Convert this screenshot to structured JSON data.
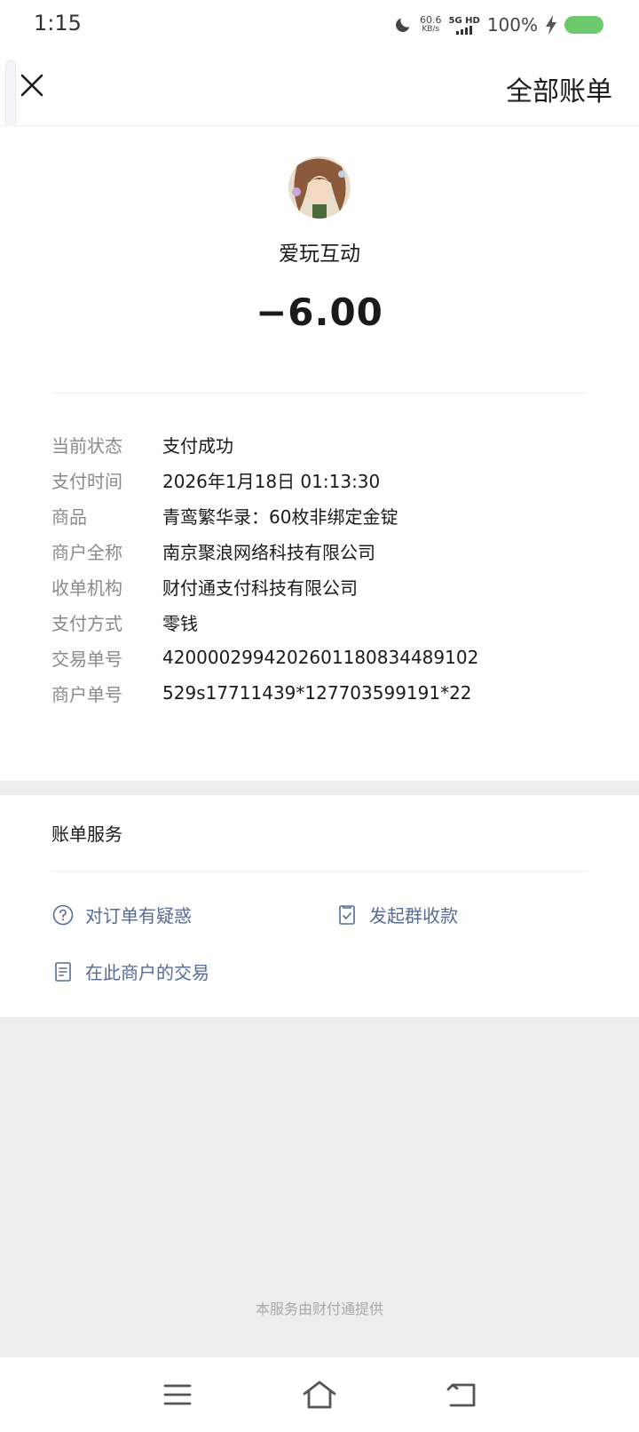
{
  "status_bar": {
    "time": "1:15",
    "net_speed_value": "60.6",
    "net_speed_unit": "KB/s",
    "network_label": "5G HD",
    "battery_percent": "100%",
    "battery_color": "#6cc96e"
  },
  "header": {
    "close_icon": "close-icon",
    "all_bills_label": "全部账单"
  },
  "transaction": {
    "merchant_name": "爱玩互动",
    "amount": "−6.00",
    "details": [
      {
        "label": "当前状态",
        "value": "支付成功"
      },
      {
        "label": "支付时间",
        "value": "2026年1月18日 01:13:30"
      },
      {
        "label": "商品",
        "value": "青鸾繁华录：60枚非绑定金锭"
      },
      {
        "label": "商户全称",
        "value": "南京聚浪网络科技有限公司"
      },
      {
        "label": "收单机构",
        "value": "财付通支付科技有限公司"
      },
      {
        "label": "支付方式",
        "value": "零钱"
      },
      {
        "label": "交易单号",
        "value": "4200002994202601180834489102"
      },
      {
        "label": "商户单号",
        "value": "529s17711439*127703599191*22"
      }
    ]
  },
  "services": {
    "title": "账单服务",
    "items": [
      {
        "label": "对订单有疑惑",
        "icon": "question-icon"
      },
      {
        "label": "发起群收款",
        "icon": "group-collect-icon"
      },
      {
        "label": "在此商户的交易",
        "icon": "document-icon"
      }
    ],
    "link_color": "#576b95"
  },
  "footer": {
    "note": "本服务由财付通提供"
  },
  "nav_bar": {
    "menu_icon": "menu-icon",
    "home_icon": "home-icon",
    "back_icon": "back-icon"
  }
}
